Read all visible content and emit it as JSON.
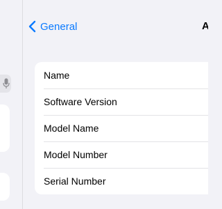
{
  "nav": {
    "back_label": "General",
    "title": "A"
  },
  "about": {
    "rows": [
      {
        "label": "Name"
      },
      {
        "label": "Software Version"
      },
      {
        "label": "Model Name"
      },
      {
        "label": "Model Number"
      },
      {
        "label": "Serial Number"
      }
    ]
  },
  "colors": {
    "accent": "#0a7aff",
    "background": "#f2f2f7",
    "card": "#ffffff",
    "separator": "#e3e3e6"
  },
  "icons": {
    "back": "chevron-left-icon",
    "mic": "microphone-icon"
  }
}
